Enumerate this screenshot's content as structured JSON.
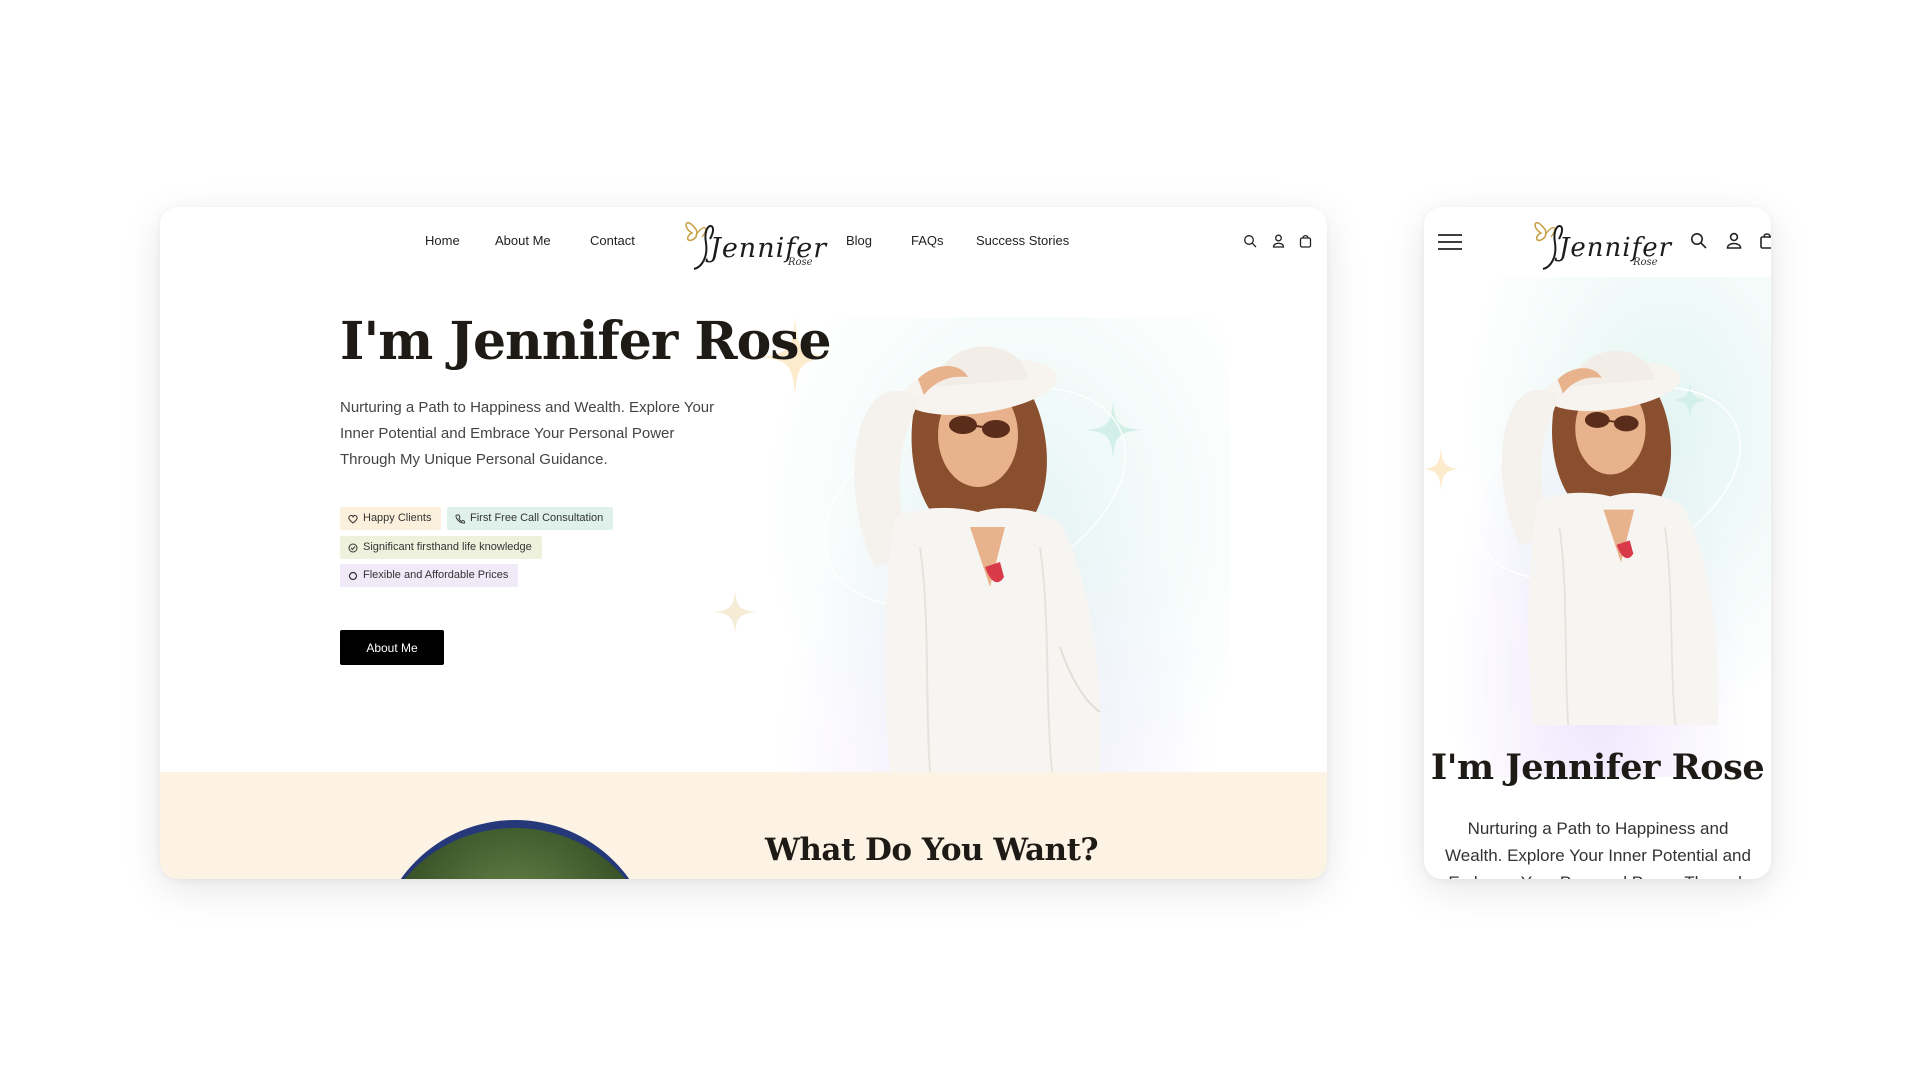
{
  "desktop": {
    "nav": {
      "left_links": [
        "Home",
        "About Me",
        "Contact"
      ],
      "right_links": [
        "Blog",
        "FAQs",
        "Success Stories"
      ],
      "icons": [
        "search-icon",
        "user-icon",
        "bag-icon"
      ]
    },
    "logo": {
      "word": "Jennifer",
      "sub": "Rose",
      "accent_color": "#c9a24a"
    },
    "hero": {
      "title": "I'm Jennifer Rose",
      "subtitle": "Nurturing a Path to Happiness and Wealth. Explore Your Inner Potential and Embrace Your Personal Power Through My Unique Personal Guidance.",
      "tags": [
        {
          "label": "Happy Clients",
          "icon": "heart-icon",
          "color": "#fbf0dc"
        },
        {
          "label": "First Free Call Consultation",
          "icon": "phone-icon",
          "color": "#dff1ea"
        },
        {
          "label": "Significant firsthand life knowledge",
          "icon": "check-circle-icon",
          "color": "#eef2dd"
        },
        {
          "label": "Flexible and Affordable Prices",
          "icon": "circle-icon",
          "color": "#efe9f8"
        }
      ],
      "button_label": "About Me"
    },
    "section": {
      "title": "What Do You Want?",
      "background": "#fdf3e4"
    }
  },
  "mobile": {
    "icons": [
      "menu-icon",
      "search-icon",
      "user-icon",
      "bag-icon"
    ],
    "logo": {
      "word": "Jennifer",
      "sub": "Rose"
    },
    "hero": {
      "title": "I'm Jennifer Rose",
      "subtitle": "Nurturing a Path to Happiness and Wealth. Explore Your Inner Potential and Embrace Your Personal Power Through My Unique Personal Guidance."
    }
  }
}
